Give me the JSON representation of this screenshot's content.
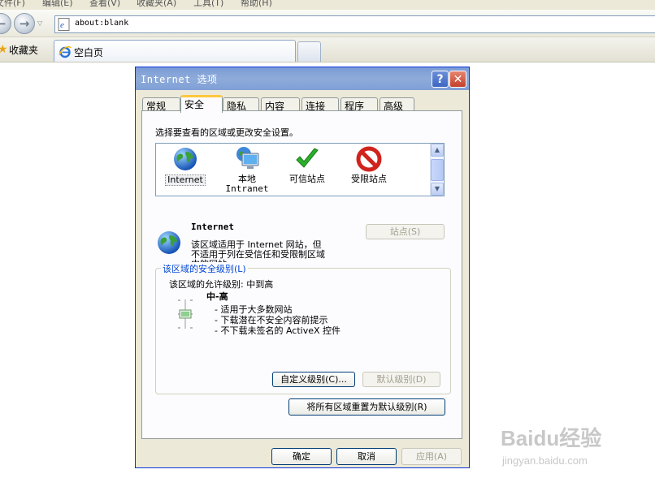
{
  "menubar": {
    "items": [
      "文件(F)",
      "编辑(E)",
      "查看(V)",
      "收藏夹(A)",
      "工具(T)",
      "帮助(H)"
    ]
  },
  "address": {
    "url": "about:blank",
    "icon": "ie-page-icon"
  },
  "favorites": {
    "label": "收藏夹",
    "icon": "star-icon"
  },
  "tab": {
    "title": "空白页",
    "icon": "ie-icon"
  },
  "dialog": {
    "title": "Internet 选项",
    "tabs": [
      "常规",
      "安全",
      "隐私",
      "内容",
      "连接",
      "程序",
      "高级"
    ],
    "selected_tab": "安全",
    "security": {
      "instruction": "选择要查看的区域或更改安全设置。",
      "zones": [
        {
          "label": "Internet",
          "label2": "",
          "icon": "globe-icon"
        },
        {
          "label": "本地",
          "label2": "Intranet",
          "icon": "monitor-globe-icon"
        },
        {
          "label": "可信站点",
          "label2": "",
          "icon": "checkmark-icon"
        },
        {
          "label": "受限站点",
          "label2": "",
          "icon": "restricted-icon"
        }
      ],
      "selected_zone": "Internet",
      "sites_button": "站点(S)",
      "zone_desc": {
        "title": "Internet",
        "lines": [
          "该区域适用于 Internet 网站，但",
          "不适用于列在受信任和受限制区域",
          "中的网站。"
        ]
      },
      "level_group": {
        "title": "该区域的安全级别(L)",
        "allowed": "该区域的允许级别: 中到高",
        "level_name": "中-高",
        "bullets": [
          "- 适用于大多数网站",
          "- 下载潜在不安全内容前提示",
          "- 不下载未签名的 ActiveX 控件"
        ],
        "custom_button": "自定义级别(C)...",
        "default_button": "默认级别(D)"
      },
      "reset_all_button": "将所有区域重置为默认级别(R)"
    },
    "buttons": {
      "ok": "确定",
      "cancel": "取消",
      "apply": "应用(A)"
    },
    "help_button": "?",
    "close_button": "✕"
  },
  "watermark": {
    "logo": "Baidu经验",
    "url": "jingyan.baidu.com"
  }
}
